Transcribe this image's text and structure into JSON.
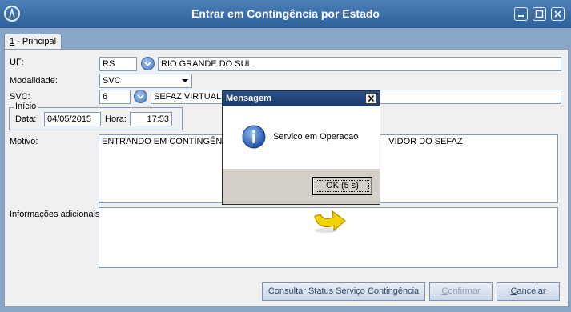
{
  "window": {
    "title": "Entrar em Contingência por Estado",
    "controls": [
      "minimize-icon",
      "maximize-icon",
      "close-icon"
    ]
  },
  "tab": {
    "number": "1",
    "label": " - Principal"
  },
  "form": {
    "uf_label": "UF:",
    "uf_code": "RS",
    "uf_name": "RIO GRANDE DO SUL",
    "modalidade_label": "Modalidade:",
    "modalidade_value": "SVC",
    "svc_label": "SVC:",
    "svc_code": "6",
    "svc_name": "SEFAZ VIRTUAL A",
    "inicio_legend": "Início",
    "data_label": "Data:",
    "data_value": "04/05/2015",
    "hora_label": "Hora:",
    "hora_value": "17:53",
    "motivo_label": "Motivo:",
    "motivo_part1": "ENTRANDO EM CONTINGÊNC",
    "motivo_part2": "VIDOR DO SEFAZ",
    "info_label": "Informações adicionais:",
    "info_value": ""
  },
  "buttons": {
    "consultar": "Consultar Status Serviço Contingência",
    "confirmar_first": "C",
    "confirmar_rest": "onfirmar",
    "cancelar_first": "C",
    "cancelar_rest": "ancelar"
  },
  "dialog": {
    "title": "Mensagem",
    "message": "Servico em Operacao",
    "ok_label": "OK (5 s)",
    "icon": "info-icon"
  },
  "colors": {
    "titlebar": "#2d5f99",
    "frame": "#8aa7c9",
    "dialog_title": "#1d3b6b",
    "pointer": "#f2d400"
  }
}
